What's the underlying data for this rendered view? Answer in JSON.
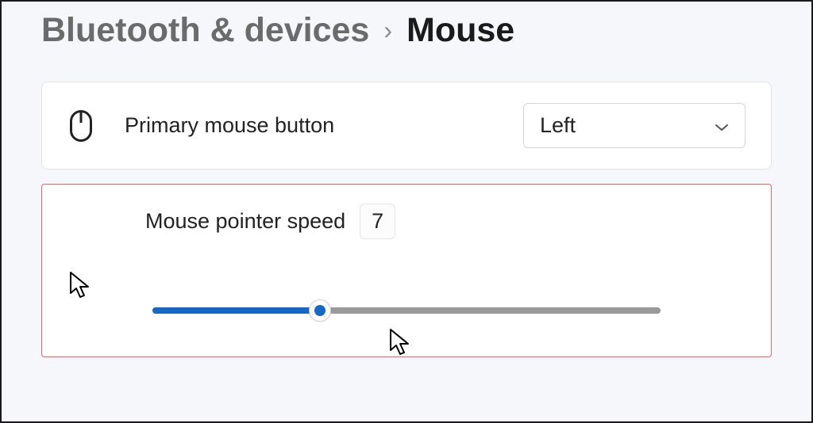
{
  "breadcrumb": {
    "parent": "Bluetooth & devices",
    "separator": "›",
    "current": "Mouse"
  },
  "primaryButton": {
    "label": "Primary mouse button",
    "selected": "Left"
  },
  "pointerSpeed": {
    "label": "Mouse pointer speed",
    "value": "7",
    "min": 1,
    "max": 20,
    "sliderPercent": 33
  }
}
